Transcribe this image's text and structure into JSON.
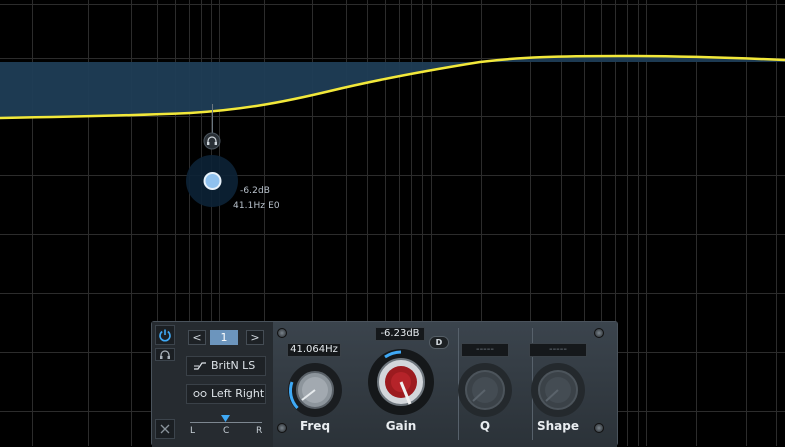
{
  "eq_display": {
    "node": {
      "gain_readout": "-6.2dB",
      "freq_readout": "41.1Hz E0"
    },
    "colors": {
      "curve": "#f3e93b",
      "fill": "#1e3a52",
      "node": "#8fc1ee",
      "grid": "#2e2e2e"
    }
  },
  "band_panel": {
    "power_icon": "power-icon",
    "headphone_icon": "headphones-icon",
    "close_icon": "close-icon",
    "prev_label": "<",
    "next_label": ">",
    "band_number": "1",
    "filter_type": "BritN LS",
    "channel_mode": "Left Right",
    "pan": {
      "left": "L",
      "center": "C",
      "right": "R"
    },
    "knobs": {
      "freq": {
        "label": "Freq",
        "value": "41.064Hz"
      },
      "gain": {
        "label": "Gain",
        "value": "-6.23dB",
        "dynamic_label": "D"
      },
      "q": {
        "label": "Q",
        "value": "-----"
      },
      "shape": {
        "label": "Shape",
        "value": "-----"
      }
    },
    "colors": {
      "accent": "#3fa9f5",
      "gain_knob": "#9c1b1f"
    }
  }
}
